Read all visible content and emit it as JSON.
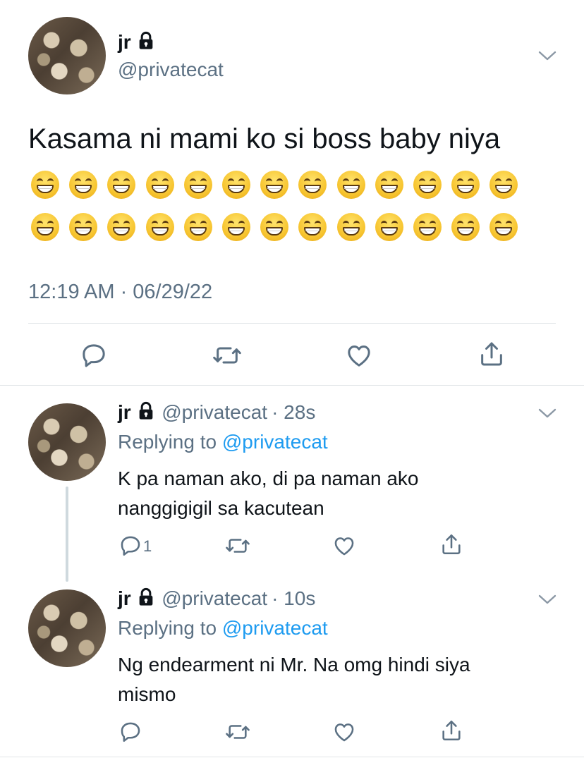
{
  "main_tweet": {
    "display_name": "jr",
    "handle": "@privatecat",
    "text": "Kasama ni mami ko si boss baby niya",
    "emoji_rows": [
      13,
      13
    ],
    "timestamp": "12:19 AM · 06/29/22"
  },
  "replies": [
    {
      "display_name": "jr",
      "handle": "@privatecat",
      "time": "· 28s",
      "replying_label": "Replying to",
      "replying_to": "@privatecat",
      "text_line1": "K pa naman ako, di pa naman ako",
      "text_line2": "nanggigigil sa kacutean",
      "reply_count": "1"
    },
    {
      "display_name": "jr",
      "handle": "@privatecat",
      "time": "· 10s",
      "replying_label": "Replying to",
      "replying_to": "@privatecat",
      "text_line1": "Ng endearment ni Mr. Na omg hindi siya",
      "text_line2": "mismo",
      "reply_count": ""
    }
  ],
  "colors": {
    "text": "#0f1419",
    "secondary": "#5b7083",
    "link": "#1d9bf0",
    "divider": "#e1e5e8"
  },
  "icons": [
    "lock-icon",
    "chevron-down-icon",
    "reply-icon",
    "retweet-icon",
    "like-icon",
    "share-icon"
  ]
}
